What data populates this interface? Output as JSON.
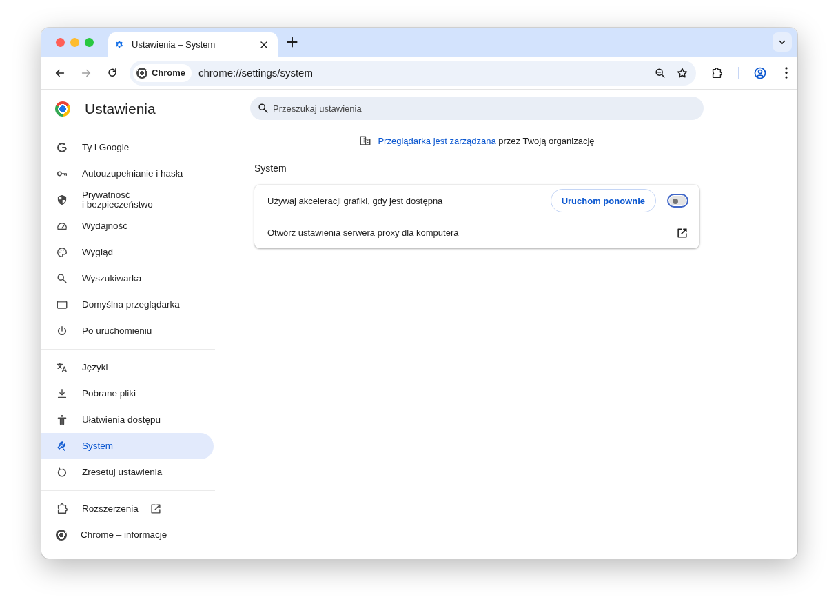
{
  "tabs": [
    {
      "title": "Ustawienia – System",
      "selected": true
    }
  ],
  "toolbar": {
    "site_chip": "Chrome",
    "url": "chrome://settings/system"
  },
  "sidebar": {
    "title": "Ustawienia",
    "groups": [
      [
        {
          "label": "Ty i Google",
          "selected": false,
          "external": false
        },
        {
          "label": "Autouzupełnianie i hasła",
          "selected": false,
          "external": false
        },
        {
          "label": "Prywatność\ni bezpieczeństwo",
          "selected": false,
          "external": false
        },
        {
          "label": "Wydajność",
          "selected": false,
          "external": false
        },
        {
          "label": "Wygląd",
          "selected": false,
          "external": false
        },
        {
          "label": "Wyszukiwarka",
          "selected": false,
          "external": false
        },
        {
          "label": "Domyślna przeglądarka",
          "selected": false,
          "external": false
        },
        {
          "label": "Po uruchomieniu",
          "selected": false,
          "external": false
        }
      ],
      [
        {
          "label": "Języki",
          "selected": false,
          "external": false
        },
        {
          "label": "Pobrane pliki",
          "selected": false,
          "external": false
        },
        {
          "label": "Ułatwienia dostępu",
          "selected": false,
          "external": false
        },
        {
          "label": "System",
          "selected": true,
          "external": false
        },
        {
          "label": "Zresetuj ustawienia",
          "selected": false,
          "external": false
        }
      ],
      [
        {
          "label": "Rozszerzenia",
          "selected": false,
          "external": true
        },
        {
          "label": "Chrome – informacje",
          "selected": false,
          "external": false
        }
      ]
    ]
  },
  "main": {
    "search": {
      "placeholder": "Przeszukaj ustawienia"
    },
    "managed_notice": {
      "link": "Przeglądarka jest zarządzana",
      "text": " przez Twoją organizację"
    },
    "section_title": "System",
    "rows": [
      {
        "kind": "toggle",
        "label": "Używaj akceleracji grafiki, gdy jest dostępna",
        "button": "Uruchom ponownie",
        "on": false
      },
      {
        "kind": "link",
        "label": "Otwórz ustawienia serwera proxy dla komputera"
      }
    ]
  }
}
